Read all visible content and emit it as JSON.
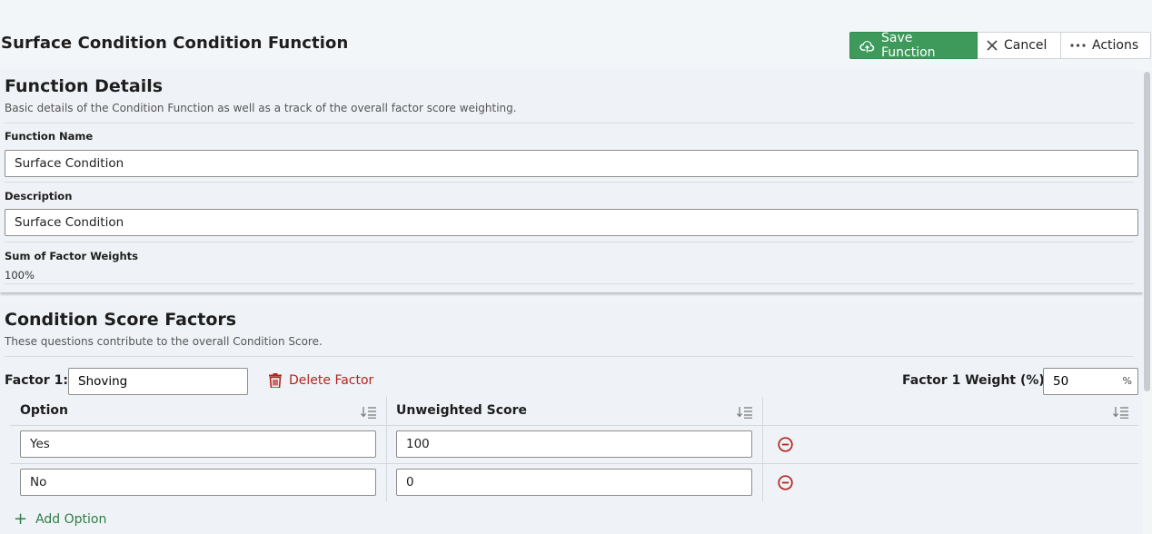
{
  "header": {
    "title": "Surface Condition Condition Function",
    "save_label": "Save Function",
    "cancel_label": "Cancel",
    "actions_label": "Actions"
  },
  "details": {
    "title": "Function Details",
    "subtitle": "Basic details of the Condition Function as well as a track of the overall factor score weighting.",
    "name_label": "Function Name",
    "name_value": "Surface Condition",
    "description_label": "Description",
    "description_value": "Surface Condition",
    "sum_label": "Sum of Factor Weights",
    "sum_value": "100%"
  },
  "factors": {
    "title": "Condition Score Factors",
    "subtitle": "These questions contribute to the overall Condition Score.",
    "factor_label": "Factor 1:",
    "factor_value": "Shoving",
    "delete_label": "Delete Factor",
    "weight_label": "Factor 1 Weight (%):",
    "weight_value": "50",
    "weight_unit": "%",
    "columns": [
      "Option",
      "Unweighted Score"
    ],
    "rows": [
      {
        "option": "Yes",
        "score": "100"
      },
      {
        "option": "No",
        "score": "0"
      }
    ],
    "add_option_label": "Add Option"
  },
  "colors": {
    "primary": "#3d9a5b",
    "danger": "#b3261e",
    "link_green": "#2f7d46"
  }
}
